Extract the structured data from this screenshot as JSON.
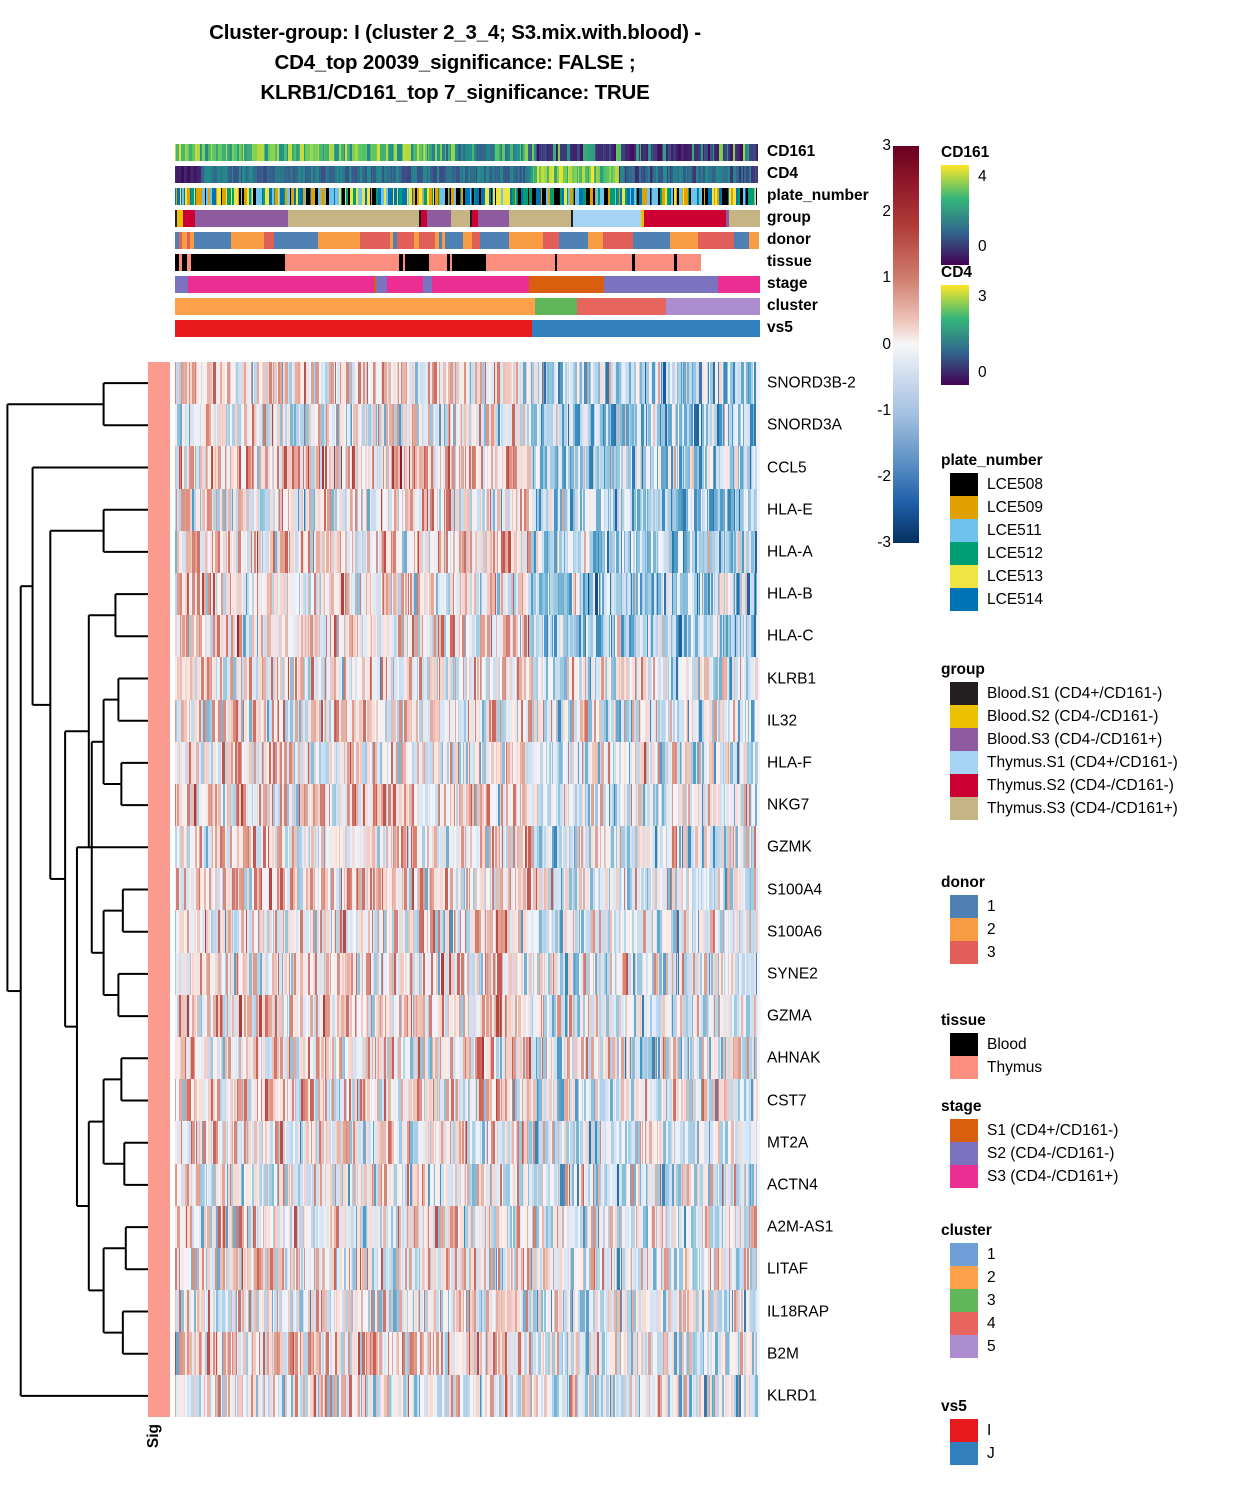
{
  "title": {
    "line1": "Cluster-group: I (cluster 2_3_4; S3.mix.with.blood) -",
    "line2": "CD4_top 20039_significance: FALSE ;",
    "line3": "KLRB1/CD161_top 7_significance: TRUE"
  },
  "sig_label": "Sig",
  "annotation_tracks": [
    {
      "name": "CD161"
    },
    {
      "name": "CD4"
    },
    {
      "name": "plate_number"
    },
    {
      "name": "group"
    },
    {
      "name": "donor"
    },
    {
      "name": "tissue"
    },
    {
      "name": "stage"
    },
    {
      "name": "cluster"
    },
    {
      "name": "vs5"
    }
  ],
  "genes": [
    "SNORD3B-2",
    "SNORD3A",
    "CCL5",
    "HLA-E",
    "HLA-A",
    "HLA-B",
    "HLA-C",
    "KLRB1",
    "IL32",
    "HLA-F",
    "NKG7",
    "GZMK",
    "S100A4",
    "S100A6",
    "SYNE2",
    "GZMA",
    "AHNAK",
    "CST7",
    "MT2A",
    "ACTN4",
    "A2M-AS1",
    "LITAF",
    "IL18RAP",
    "B2M",
    "KLRD1"
  ],
  "colorbar": {
    "ticks": [
      "3",
      "2",
      "1",
      "0",
      "-1",
      "-2",
      "-3"
    ],
    "max": 3,
    "min": -3,
    "high_color": "#67001f",
    "mid_color": "#f7f7f7",
    "low_color": "#053061"
  },
  "legends": [
    {
      "title": "CD161",
      "type": "continuous",
      "colors": [
        "#fde725",
        "#35b779",
        "#31688e",
        "#440154"
      ],
      "ticks": [
        {
          "label": "4",
          "pos": 12
        },
        {
          "label": "0",
          "pos": 82
        }
      ]
    },
    {
      "title": "CD4",
      "type": "continuous",
      "colors": [
        "#fde725",
        "#35b779",
        "#31688e",
        "#440154"
      ],
      "ticks": [
        {
          "label": "3",
          "pos": 12
        },
        {
          "label": "0",
          "pos": 88
        }
      ]
    },
    {
      "title": "plate_number",
      "type": "discrete",
      "entries": [
        {
          "label": "LCE508",
          "color": "#000000"
        },
        {
          "label": "LCE509",
          "color": "#e1a100"
        },
        {
          "label": "LCE511",
          "color": "#6ec2ec"
        },
        {
          "label": "LCE512",
          "color": "#009e73"
        },
        {
          "label": "LCE513",
          "color": "#f0e442"
        },
        {
          "label": "LCE514",
          "color": "#0073b5"
        }
      ]
    },
    {
      "title": "group",
      "type": "discrete",
      "entries": [
        {
          "label": "Blood.S1 (CD4+/CD161-)",
          "color": "#231f20"
        },
        {
          "label": "Blood.S2 (CD4-/CD161-)",
          "color": "#edc100"
        },
        {
          "label": "Blood.S3 (CD4-/CD161+)",
          "color": "#8e5ba0"
        },
        {
          "label": "Thymus.S1 (CD4+/CD161-)",
          "color": "#a5d3f3"
        },
        {
          "label": "Thymus.S2 (CD4-/CD161-)",
          "color": "#cc0033"
        },
        {
          "label": "Thymus.S3 (CD4-/CD161+)",
          "color": "#c6b484"
        }
      ]
    },
    {
      "title": "donor",
      "type": "discrete",
      "entries": [
        {
          "label": "1",
          "color": "#4f81b5"
        },
        {
          "label": "2",
          "color": "#f79c42"
        },
        {
          "label": "3",
          "color": "#e05f58"
        }
      ]
    },
    {
      "title": "tissue",
      "type": "discrete",
      "entries": [
        {
          "label": "Blood",
          "color": "#000000"
        },
        {
          "label": "Thymus",
          "color": "#fb8e7f"
        }
      ]
    },
    {
      "title": "stage",
      "type": "discrete",
      "entries": [
        {
          "label": "S1 (CD4+/CD161-)",
          "color": "#d95f0e"
        },
        {
          "label": "S2 (CD4-/CD161-)",
          "color": "#7b73bf"
        },
        {
          "label": "S3 (CD4-/CD161+)",
          "color": "#ec2d92"
        }
      ]
    },
    {
      "title": "cluster",
      "type": "discrete",
      "entries": [
        {
          "label": "1",
          "color": "#6f9fd8"
        },
        {
          "label": "2",
          "color": "#fca04a"
        },
        {
          "label": "3",
          "color": "#60b75a"
        },
        {
          "label": "4",
          "color": "#e8655e"
        },
        {
          "label": "5",
          "color": "#ac8dd0"
        }
      ]
    },
    {
      "title": "vs5",
      "type": "discrete",
      "entries": [
        {
          "label": "I",
          "color": "#e8191c"
        },
        {
          "label": "J",
          "color": "#3280bd"
        }
      ]
    }
  ],
  "chart_data": {
    "type": "heatmap",
    "title": "Cluster-group: I (cluster 2_3_4; S3.mix.with.blood) - CD4_top 20039_significance: FALSE ; KLRB1/CD161_top 7_significance: TRUE",
    "value_range": [
      -3,
      3
    ],
    "colormap": "RdBu_r",
    "rows": [
      "SNORD3B-2",
      "SNORD3A",
      "CCL5",
      "HLA-E",
      "HLA-A",
      "HLA-B",
      "HLA-C",
      "KLRB1",
      "IL32",
      "HLA-F",
      "NKG7",
      "GZMK",
      "S100A4",
      "S100A6",
      "SYNE2",
      "GZMA",
      "AHNAK",
      "CST7",
      "MT2A",
      "ACTN4",
      "A2M-AS1",
      "LITAF",
      "IL18RAP",
      "B2M",
      "KLRD1"
    ],
    "row_label_side": "right",
    "row_dendrogram": true,
    "column_dendrogram": false,
    "n_columns_approx": 470,
    "column_annotations": [
      "CD161",
      "CD4",
      "plate_number",
      "group",
      "donor",
      "tissue",
      "stage",
      "cluster",
      "vs5"
    ],
    "row_annotation": "Sig",
    "row_mean_bias": [
      0.25,
      -0.05,
      0.55,
      0.1,
      0.25,
      0.2,
      0.3,
      0.12,
      0.18,
      0.1,
      0.3,
      0.25,
      0.22,
      0.2,
      0.15,
      0.3,
      0.22,
      0.25,
      0.1,
      0.12,
      0.1,
      0.15,
      0.08,
      0.35,
      0.1
    ],
    "left_block_fraction": 0.61,
    "left_block_label": "I",
    "right_block_label": "J",
    "cluster_segments": [
      {
        "label": "2",
        "fraction": 0.615
      },
      {
        "label": "3",
        "fraction": 0.072
      },
      {
        "label": "4",
        "fraction": 0.152
      },
      {
        "label": "5",
        "fraction": 0.161
      }
    ]
  }
}
